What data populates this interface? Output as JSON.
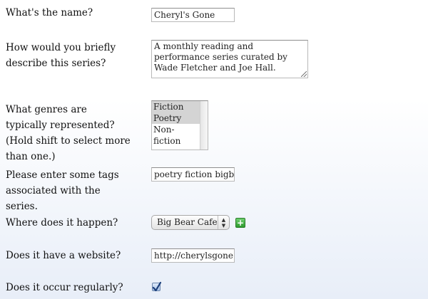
{
  "form": {
    "name": {
      "label": "What's the name?",
      "value": "Cheryl's Gone"
    },
    "description": {
      "label": "How would you briefly describe this series?",
      "value": "A monthly reading and performance series curated by Wade Fletcher and Joe Hall."
    },
    "genres": {
      "label": "What genres are typically represented? (Hold shift to select more than one.)",
      "options": [
        {
          "label": "Fiction",
          "selected": true
        },
        {
          "label": "Poetry",
          "selected": true
        },
        {
          "label": "Non-fiction",
          "selected": false
        }
      ]
    },
    "tags": {
      "label": "Please enter some tags associated with the series.",
      "value": "poetry fiction bigbea"
    },
    "location": {
      "label": "Where does it happen?",
      "selected": "Big Bear Cafe",
      "add_icon": "plus-icon",
      "add_color": "#3aa93a"
    },
    "website": {
      "label": "Does it have a website?",
      "value": "http://cherylsgone.c"
    },
    "regular": {
      "label": "Does it occur regularly?",
      "checked": true
    }
  }
}
